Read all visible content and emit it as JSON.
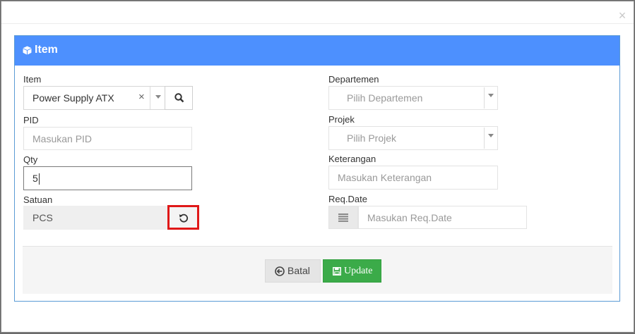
{
  "modal": {
    "close_label": "×"
  },
  "panel": {
    "title": "Item",
    "icon": "cube-icon"
  },
  "left": {
    "item": {
      "label": "Item",
      "value": "Power Supply ATX",
      "clear": "×"
    },
    "pid": {
      "label": "PID",
      "placeholder": "Masukan PID"
    },
    "qty": {
      "label": "Qty",
      "value": "5"
    },
    "satuan": {
      "label": "Satuan",
      "value": "PCS"
    }
  },
  "right": {
    "departemen": {
      "label": "Departemen",
      "placeholder": "Pilih Departemen"
    },
    "projek": {
      "label": "Projek",
      "placeholder": "Pilih Projek"
    },
    "keterangan": {
      "label": "Keterangan",
      "placeholder": "Masukan Keterangan"
    },
    "reqdate": {
      "label": "Req.Date",
      "placeholder": "Masukan Req.Date"
    }
  },
  "footer": {
    "cancel_label": "Batal",
    "update_label": "Update"
  },
  "colors": {
    "header": "#4d90fe",
    "update": "#3bab49",
    "highlight": "#e01818"
  }
}
